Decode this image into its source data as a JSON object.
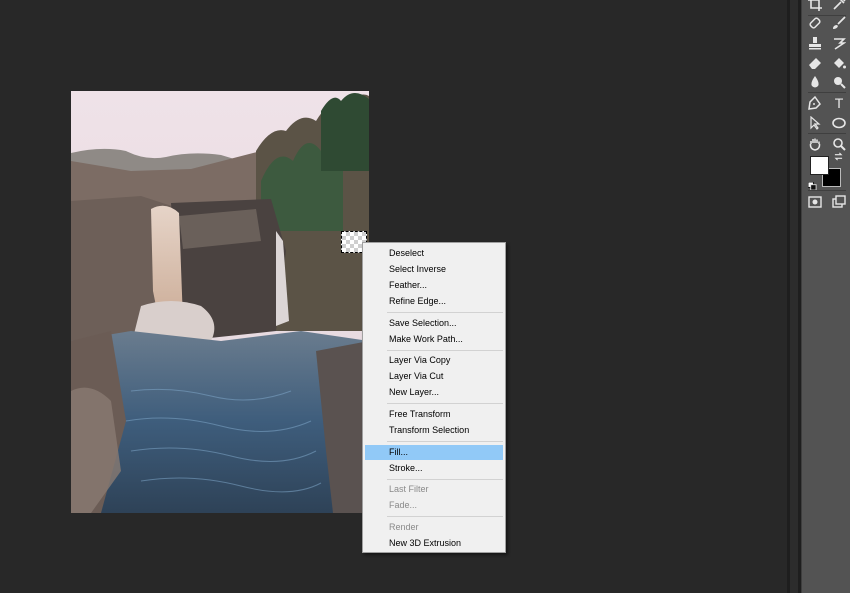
{
  "context_menu": {
    "items": [
      {
        "label": "Deselect",
        "enabled": true
      },
      {
        "label": "Select Inverse",
        "enabled": true
      },
      {
        "label": "Feather...",
        "enabled": true
      },
      {
        "label": "Refine Edge...",
        "enabled": true
      },
      {
        "label": "Save Selection...",
        "enabled": true
      },
      {
        "label": "Make Work Path...",
        "enabled": true
      },
      {
        "label": "Layer Via Copy",
        "enabled": true
      },
      {
        "label": "Layer Via Cut",
        "enabled": true
      },
      {
        "label": "New Layer...",
        "enabled": true
      },
      {
        "label": "Free Transform",
        "enabled": true
      },
      {
        "label": "Transform Selection",
        "enabled": true
      },
      {
        "label": "Fill...",
        "enabled": true,
        "highlighted": true
      },
      {
        "label": "Stroke...",
        "enabled": true
      },
      {
        "label": "Last Filter",
        "enabled": false
      },
      {
        "label": "Fade...",
        "enabled": false
      },
      {
        "label": "Render",
        "enabled": false
      },
      {
        "label": "New 3D Extrusion",
        "enabled": true
      }
    ]
  },
  "toolbar": {
    "tools": [
      [
        "crop-icon",
        "eyedropper-icon"
      ],
      [
        "spot-healing-brush-icon",
        "brush-icon"
      ],
      [
        "clone-stamp-icon",
        "history-brush-icon"
      ],
      [
        "eraser-icon",
        "paint-bucket-icon"
      ],
      [
        "blur-drop-icon",
        "dodge-icon"
      ],
      [
        "pen-icon",
        "type-icon"
      ],
      [
        "path-selection-icon",
        "ellipse-icon"
      ],
      [
        "hand-icon",
        "zoom-icon"
      ]
    ],
    "type_tool_glyph": "T"
  },
  "colors": {
    "foreground": "#ffffff",
    "background": "#000000",
    "highlight": "#91c9f7",
    "workspace": "#282828"
  }
}
